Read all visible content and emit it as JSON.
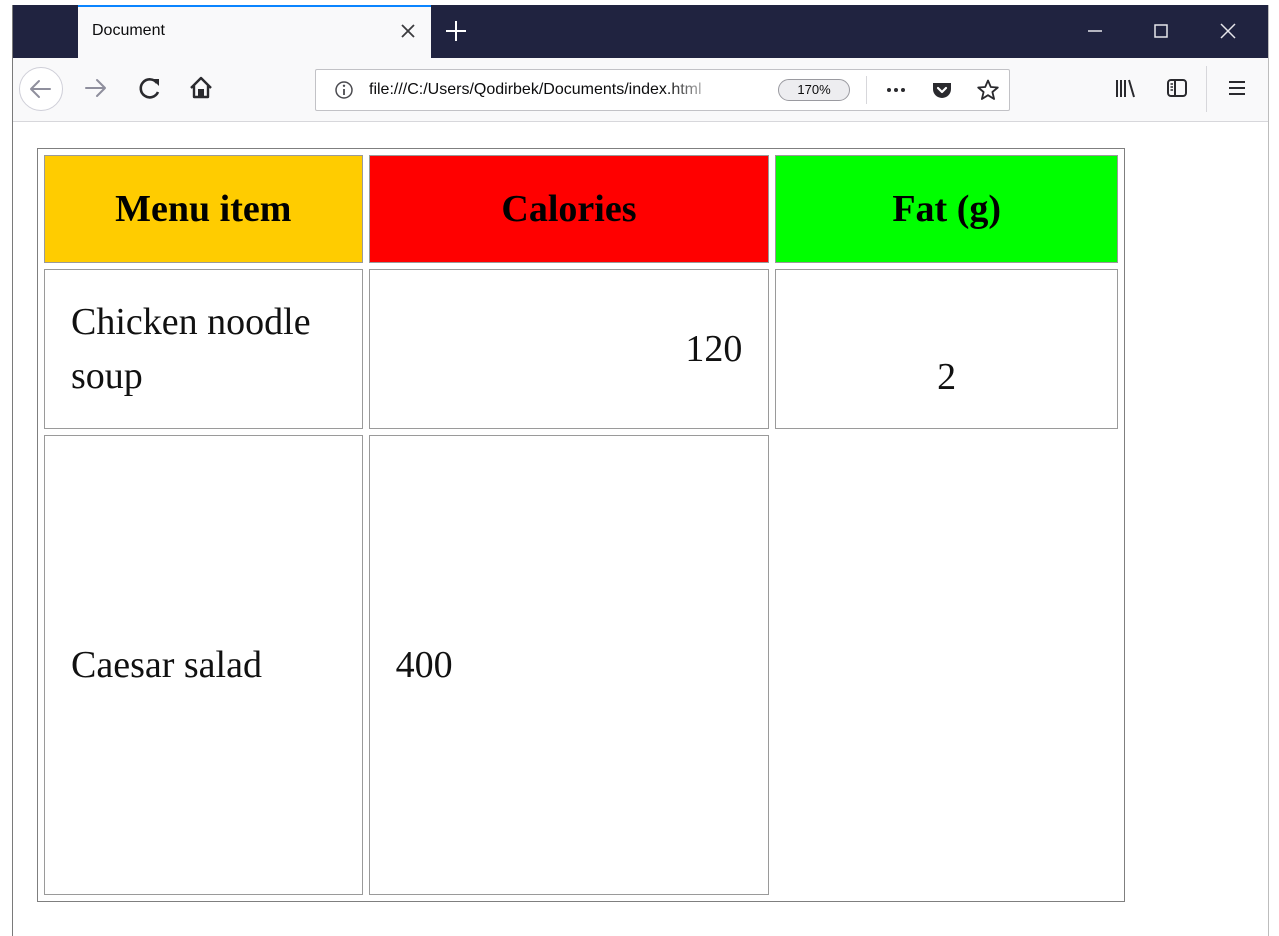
{
  "browser": {
    "tab_title": "Document",
    "url": "file:///C:/Users/Qodirbek/Documents/index.html",
    "zoom": "170%"
  },
  "colors": {
    "header_menu_item": "#ffcc00",
    "header_calories": "#ff0000",
    "header_fat": "#00ff00"
  },
  "icons": {
    "tab_close": "close-icon",
    "new_tab": "plus-icon",
    "back": "arrow-left-icon",
    "forward": "arrow-right-icon",
    "reload": "reload-icon",
    "home": "home-icon",
    "site_info": "info-icon",
    "page_actions": "ellipsis-icon",
    "pocket": "pocket-icon",
    "bookmark": "star-icon",
    "library": "library-icon",
    "sidebar": "sidebar-icon",
    "menu": "hamburger-icon"
  },
  "table": {
    "headers": [
      "Menu item",
      "Calories",
      "Fat (g)"
    ],
    "rows": [
      [
        "Chicken noodle soup",
        "120",
        "2"
      ],
      [
        "Caesar salad",
        "400",
        ""
      ]
    ]
  }
}
